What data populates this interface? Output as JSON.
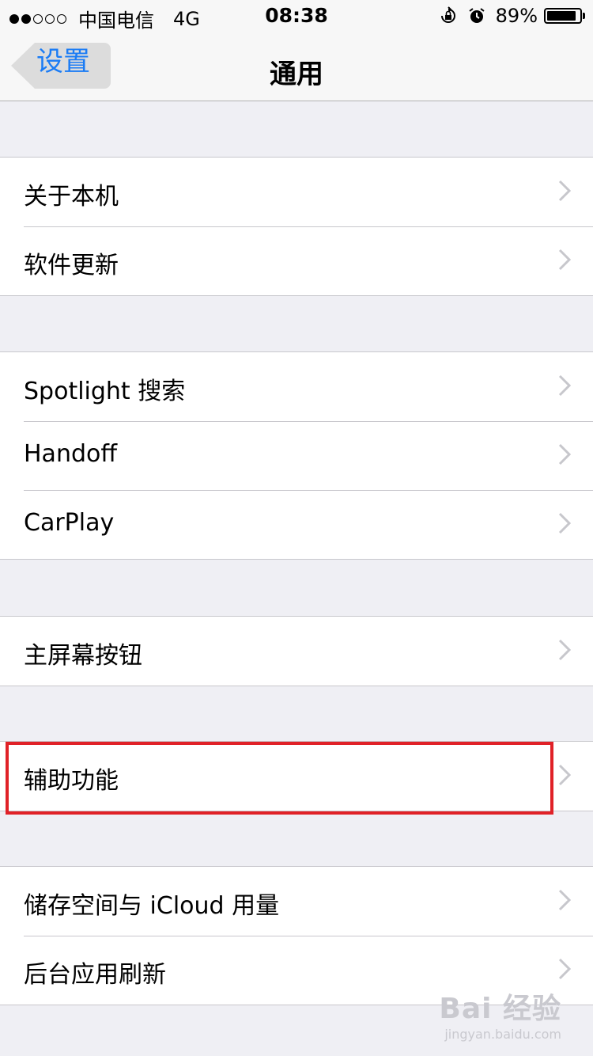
{
  "status": {
    "carrier": "中国电信",
    "network": "4G",
    "time": "08:38",
    "battery_text": "89%",
    "battery_level": 0.89,
    "signal_bars_filled": 2,
    "signal_bars_total": 5
  },
  "nav": {
    "back_label": "设置",
    "title": "通用"
  },
  "sections": [
    {
      "items": [
        "关于本机",
        "软件更新"
      ]
    },
    {
      "items": [
        "Spotlight 搜索",
        "Handoff",
        "CarPlay"
      ]
    },
    {
      "items": [
        "主屏幕按钮"
      ]
    },
    {
      "items": [
        "辅助功能"
      ]
    },
    {
      "items": [
        "储存空间与 iCloud 用量",
        "后台应用刷新"
      ]
    }
  ],
  "watermark": {
    "main": "Bai 经验",
    "sub": "jingyan.baidu.com"
  },
  "colors": {
    "accent": "#1b7cf5",
    "highlight": "#e02127",
    "background": "#efeff4"
  }
}
